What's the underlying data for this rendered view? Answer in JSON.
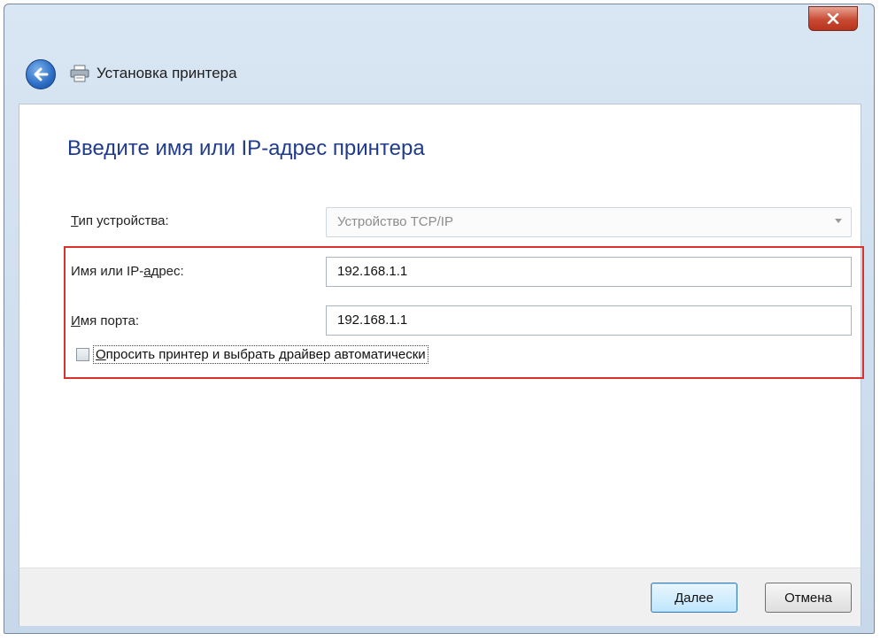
{
  "window": {
    "title": "Установка принтера"
  },
  "page": {
    "heading": "Введите имя или IP-адрес принтера"
  },
  "form": {
    "device_type": {
      "label_prefix": "Т",
      "label_rest": "ип устройства:",
      "value": "Устройство TCP/IP"
    },
    "host": {
      "label_prefix": "Имя или IP-",
      "label_accel": "а",
      "label_rest": "дрес:",
      "value": "192.168.1.1"
    },
    "port": {
      "label_accel": "И",
      "label_rest": "мя порта:",
      "value": "192.168.1.1"
    },
    "auto_driver": {
      "label_accel": "О",
      "label_rest": "просить принтер и выбрать драйвер автоматически",
      "checked": false
    }
  },
  "buttons": {
    "next": "Далее",
    "cancel": "Отмена"
  },
  "colors": {
    "heading": "#1f3b8e",
    "highlight_border": "#d9322a",
    "close_button": "#c84a33"
  }
}
